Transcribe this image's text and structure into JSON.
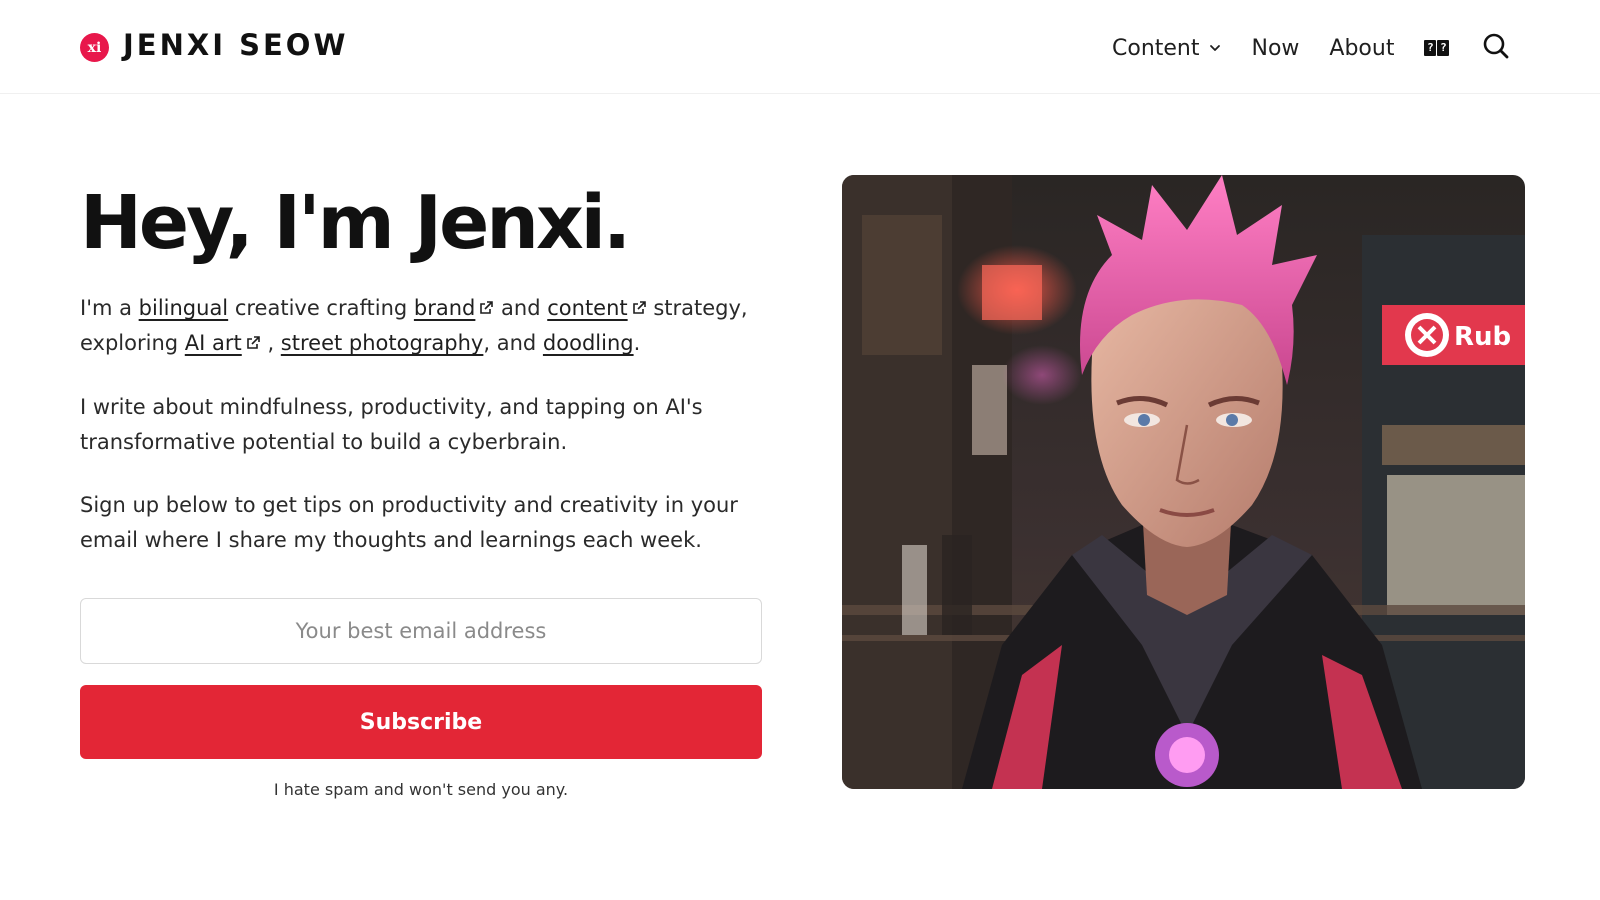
{
  "site": {
    "logo_mark": "xi",
    "logo_text": "JENXI SEOW"
  },
  "nav": {
    "content": "Content",
    "now": "Now",
    "about": "About",
    "language_glyphs": [
      "?",
      "?"
    ]
  },
  "hero": {
    "title": "Hey, I'm Jenxi.",
    "p1": {
      "t1": "I'm a ",
      "link_bilingual": "bilingual",
      "t2": " creative crafting ",
      "link_brand": "brand",
      "t3": " and ",
      "link_content": "content",
      "t4": " strategy, exploring ",
      "link_ai_art": "AI art",
      "t5": " , ",
      "link_street_photography": "street photography",
      "t6": ", and ",
      "link_doodling": "doodling",
      "t7": "."
    },
    "p2": "I write about mindfulness, productivity, and tapping on AI's transformative potential to build a cyberbrain.",
    "p3": "Sign up below to get tips on productivity and creativity in your email where I share my thoughts and learnings each week."
  },
  "signup": {
    "email_placeholder": "Your best email address",
    "subscribe_label": "Subscribe",
    "spam_note": "I hate spam and won't send you any."
  },
  "image": {
    "sign_text": "Rub"
  },
  "colors": {
    "accent": "#e32636",
    "logo": "#e8174b",
    "text": "#1f1f1f"
  }
}
